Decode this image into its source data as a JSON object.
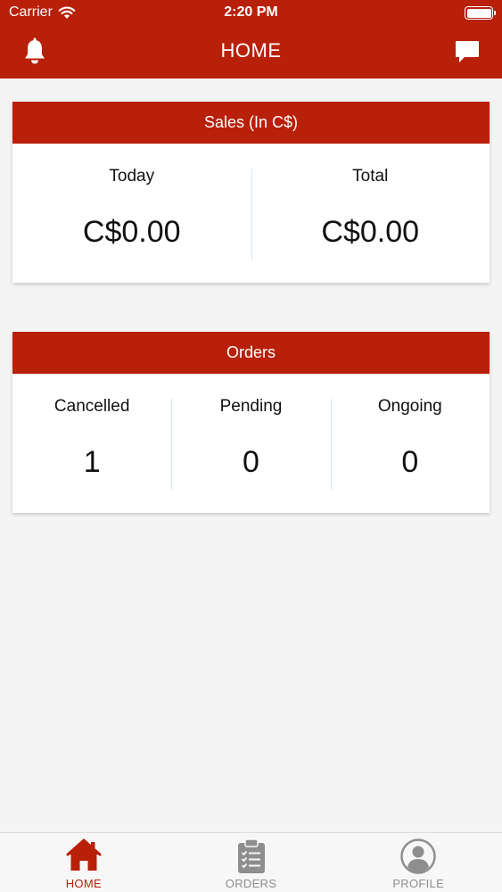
{
  "status": {
    "carrier": "Carrier",
    "time": "2:20 PM"
  },
  "nav": {
    "title": "HOME",
    "left_icon": "bell-icon",
    "right_icon": "chat-icon"
  },
  "sales": {
    "title": "Sales (In C$)",
    "items": [
      {
        "label": "Today",
        "value": "C$0.00"
      },
      {
        "label": "Total",
        "value": "C$0.00"
      }
    ]
  },
  "orders": {
    "title": "Orders",
    "items": [
      {
        "label": "Cancelled",
        "value": "1"
      },
      {
        "label": "Pending",
        "value": "0"
      },
      {
        "label": "Ongoing",
        "value": "0"
      }
    ]
  },
  "tabs": [
    {
      "label": "HOME",
      "icon": "home-icon",
      "active": true
    },
    {
      "label": "ORDERS",
      "icon": "clipboard-icon",
      "active": false
    },
    {
      "label": "PROFILE",
      "icon": "profile-icon",
      "active": false
    }
  ],
  "colors": {
    "brand": "#b8200a",
    "inactive": "#8e8e8e"
  }
}
